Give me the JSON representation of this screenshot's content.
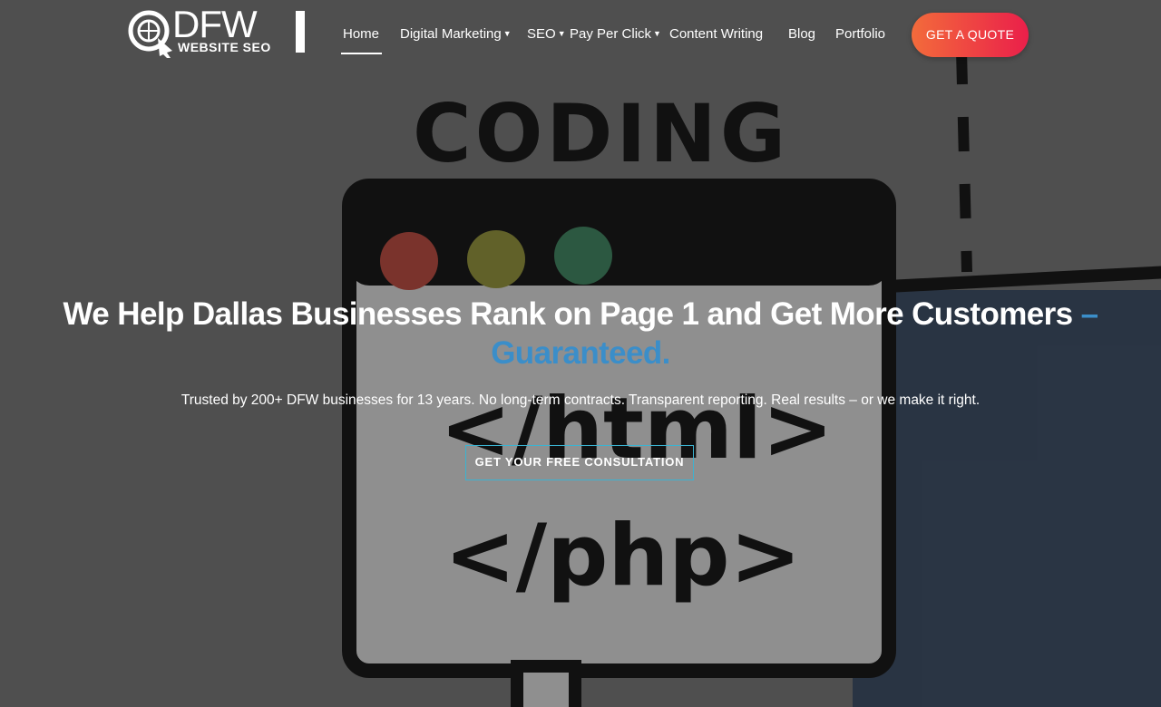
{
  "brand": {
    "logo_main": "DFW",
    "logo_sub": "WEBSITE SEO"
  },
  "nav": {
    "items": [
      {
        "label": "Home",
        "active": true,
        "has_dropdown": false
      },
      {
        "label": "Digital Marketing",
        "has_dropdown": true
      },
      {
        "label": "SEO",
        "has_dropdown": true
      },
      {
        "label": "Pay Per Click",
        "has_dropdown": true
      },
      {
        "label": "Content Writing",
        "has_dropdown": false
      },
      {
        "label": "Blog",
        "has_dropdown": false
      },
      {
        "label": "Portfolio",
        "has_dropdown": false
      }
    ],
    "caret": "▼",
    "cta_label": "GET A QUOTE"
  },
  "hero": {
    "headline_main": "We Help Dallas Businesses Rank on Page 1 and Get More Customers",
    "headline_accent_dash": "–",
    "headline_accent": "Guaranteed.",
    "subtext": "Trusted by 200+ DFW businesses for 13 years. No long-term contracts. Transparent reporting. Real results – or we make it right.",
    "cta_label": "GET YOUR FREE CONSULTATION",
    "background_art": {
      "coding_label": "CODING",
      "html_tag": "</html>",
      "php_tag": "</php>"
    }
  },
  "colors": {
    "accent_blue": "#3b8ec9",
    "quote_gradient_start": "#f36b3b",
    "quote_gradient_end": "#ea1f4a",
    "cta_border": "#3bb3d1"
  }
}
